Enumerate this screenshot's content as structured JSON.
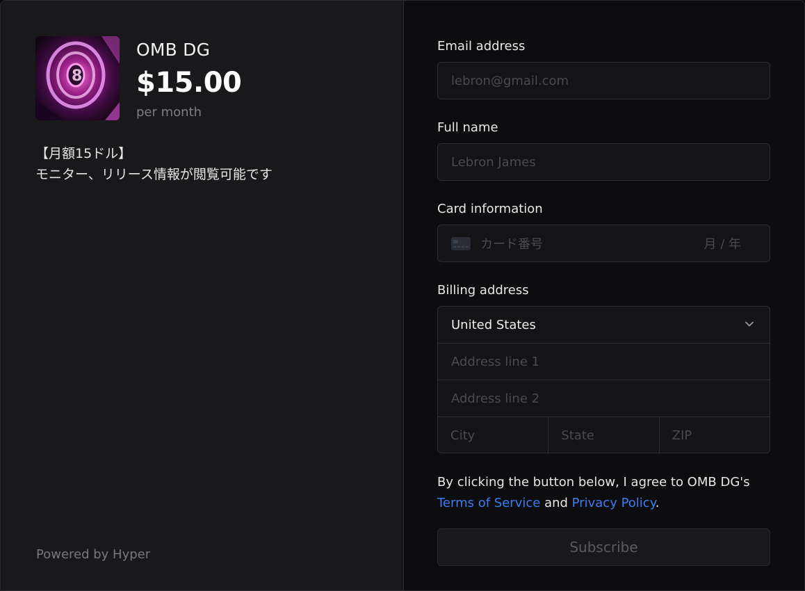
{
  "product": {
    "name": "OMB DG",
    "price": "$15.00",
    "period": "per month",
    "description_line1": "【月額15ドル】",
    "description_line2": "モニター、リリース情報が閲覧可能です"
  },
  "footer": {
    "powered_by": "Powered by Hyper"
  },
  "form": {
    "email": {
      "label": "Email address",
      "placeholder": "lebron@gmail.com"
    },
    "name": {
      "label": "Full name",
      "placeholder": "Lebron James"
    },
    "card": {
      "label": "Card information",
      "number_placeholder": "カード番号",
      "expiry_placeholder": "月 / 年",
      "icon": "credit-card-icon"
    },
    "billing": {
      "label": "Billing address",
      "country": "United States",
      "address1_placeholder": "Address line 1",
      "address2_placeholder": "Address line 2",
      "city_placeholder": "City",
      "state_placeholder": "State",
      "zip_placeholder": "ZIP"
    }
  },
  "terms": {
    "prefix": "By clicking the button below, I agree to OMB DG's",
    "tos_link": "Terms of Service",
    "and": "and",
    "privacy_link": "Privacy Policy",
    "suffix": "."
  },
  "submit_label": "Subscribe",
  "colors": {
    "link": "#3c7cf0",
    "left_bg": "#19191c",
    "right_bg": "#0d0d0f"
  }
}
